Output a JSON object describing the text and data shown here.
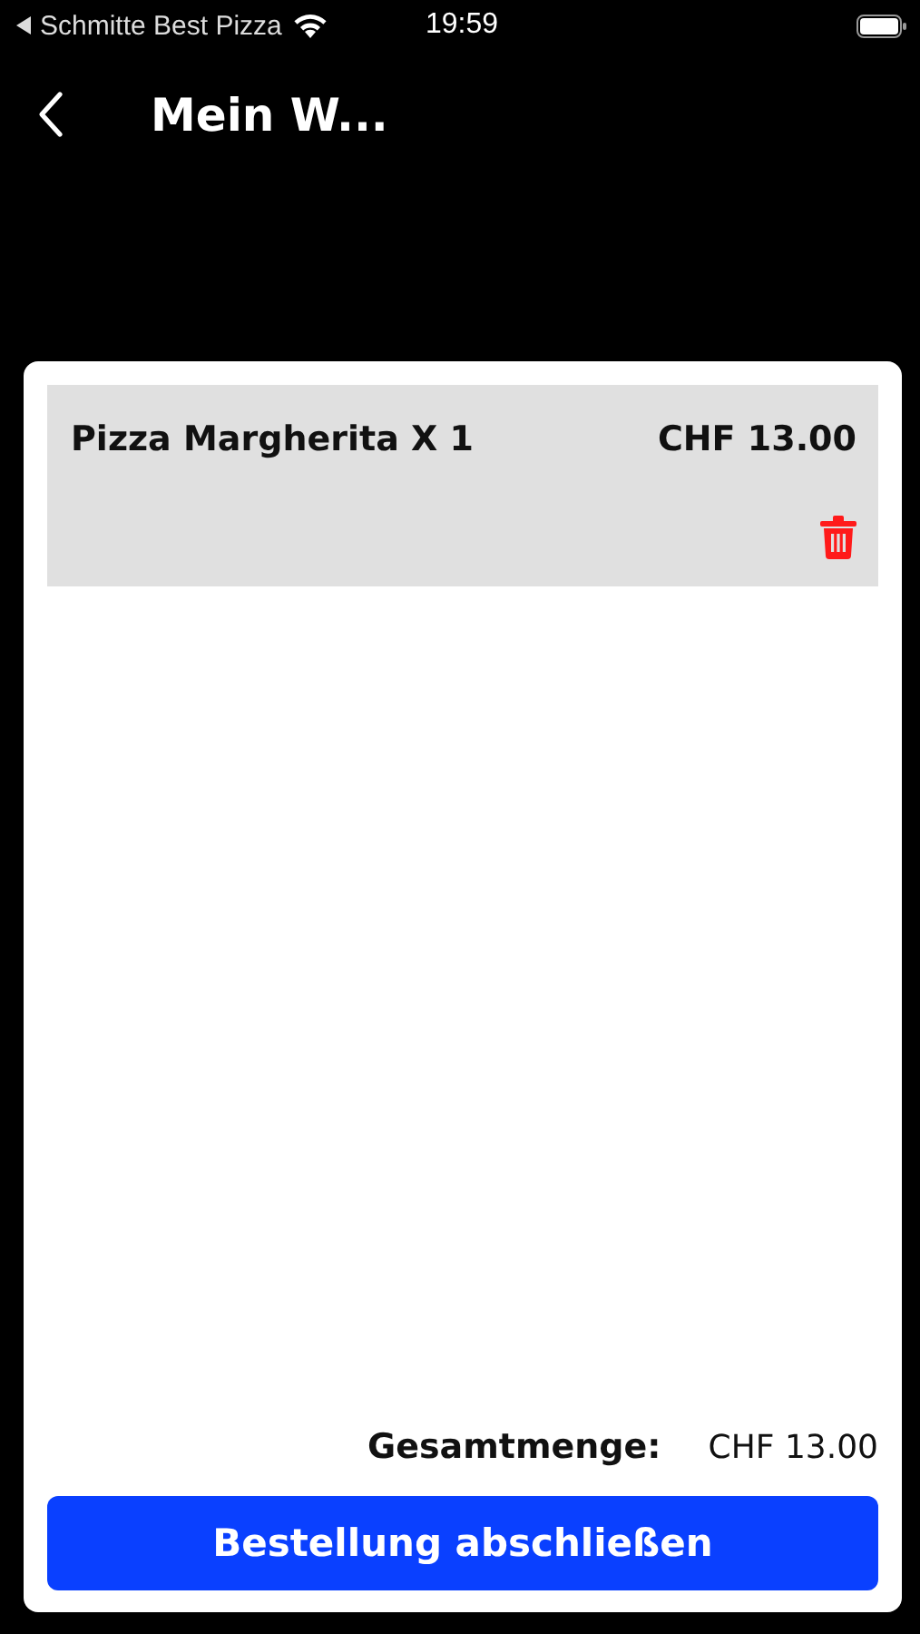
{
  "status_bar": {
    "back_app": "Schmitte Best Pizza",
    "time": "19:59"
  },
  "header": {
    "title": "Mein W..."
  },
  "cart_items": [
    {
      "name": "Pizza Margherita X 1",
      "price": "CHF 13.00"
    }
  ],
  "total": {
    "label": "Gesamtmenge:",
    "value": "CHF 13.00"
  },
  "checkout_button": "Bestellung abschließen"
}
